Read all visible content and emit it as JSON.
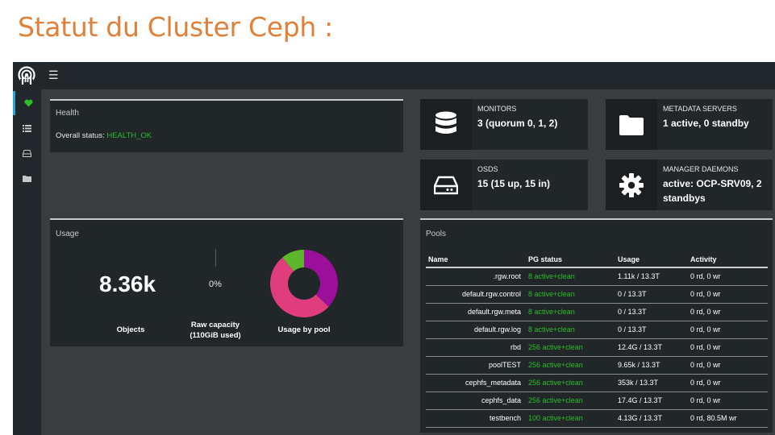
{
  "slide_title": "Statut du Cluster Ceph :",
  "colors": {
    "accent_orange": "#e0803a",
    "ok_green": "#2bbd2b",
    "panel_bg": "#212629",
    "app_bg": "#3a3d40",
    "nav_bg": "#22272b"
  },
  "topbar": {
    "menu_icon": "☰"
  },
  "sidebar": {
    "items": [
      {
        "icon": "heart-icon",
        "active": true
      },
      {
        "icon": "list-icon",
        "active": false
      },
      {
        "icon": "drive-icon",
        "active": false
      },
      {
        "icon": "folder-icon",
        "active": false
      }
    ]
  },
  "health": {
    "title": "Health",
    "status_label": "Overall status: ",
    "status_value": "HEALTH_OK"
  },
  "stats": {
    "monitors": {
      "label": "MONITORS",
      "value": "3 (quorum 0, 1, 2)"
    },
    "metadata": {
      "label": "METADATA SERVERS",
      "value": "1 active, 0 standby"
    },
    "osds": {
      "label": "OSDS",
      "value": "15 (15 up, 15 in)"
    },
    "managers": {
      "label": "MANAGER DAEMONS",
      "value": "active: OCP-SRV09, 2 standbys"
    }
  },
  "usage": {
    "title": "Usage",
    "objects_value": "8.36k",
    "objects_label": "Objects",
    "raw_pct": "0%",
    "raw_label": "Raw capacity",
    "raw_sub": "(110GiB used)",
    "pool_label": "Usage by pool",
    "donut": [
      {
        "color": "#9b0f9b",
        "fraction": 0.37
      },
      {
        "color": "#e03d7c",
        "fraction": 0.52
      },
      {
        "color": "#5cb82a",
        "fraction": 0.11
      }
    ]
  },
  "pools": {
    "title": "Pools",
    "columns": [
      "Name",
      "PG status",
      "Usage",
      "Activity"
    ],
    "rows": [
      [
        ".rgw.root",
        "8 active+clean",
        "1.11k / 13.3T",
        "0 rd, 0 wr"
      ],
      [
        "default.rgw.control",
        "8 active+clean",
        "0 / 13.3T",
        "0 rd, 0 wr"
      ],
      [
        "default.rgw.meta",
        "8 active+clean",
        "0 / 13.3T",
        "0 rd, 0 wr"
      ],
      [
        "default.rgw.log",
        "8 active+clean",
        "0 / 13.3T",
        "0 rd, 0 wr"
      ],
      [
        "rbd",
        "256 active+clean",
        "12.4G / 13.3T",
        "0 rd, 0 wr"
      ],
      [
        "poolTEST",
        "256 active+clean",
        "9.65k / 13.3T",
        "0 rd, 0 wr"
      ],
      [
        "cephfs_metadata",
        "256 active+clean",
        "353k / 13.3T",
        "0 rd, 0 wr"
      ],
      [
        "cephfs_data",
        "256 active+clean",
        "17.4G / 13.3T",
        "0 rd, 0 wr"
      ],
      [
        "testbench",
        "100 active+clean",
        "4.13G / 13.3T",
        "0 rd, 80.5M wr"
      ]
    ]
  }
}
